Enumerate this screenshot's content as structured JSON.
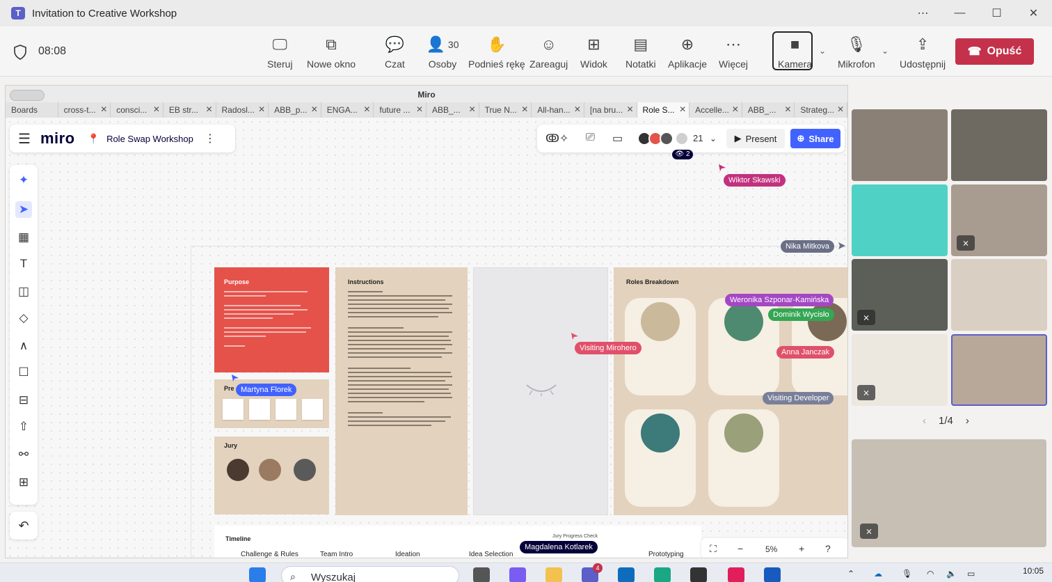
{
  "window": {
    "title": "Invitation to Creative Workshop"
  },
  "meeting": {
    "timer": "08:08",
    "toolbar": [
      {
        "label": "Steruj",
        "icon": "control-icon"
      },
      {
        "label": "Nowe okno",
        "icon": "popout-icon"
      },
      {
        "label": "Czat",
        "icon": "chat-icon"
      },
      {
        "label": "Osoby",
        "icon": "people-icon",
        "count": "30"
      },
      {
        "label": "Podnieś rękę",
        "icon": "raise-hand-icon"
      },
      {
        "label": "Zareaguj",
        "icon": "react-icon"
      },
      {
        "label": "Widok",
        "icon": "view-icon"
      },
      {
        "label": "Notatki",
        "icon": "notes-icon"
      },
      {
        "label": "Aplikacje",
        "icon": "apps-icon"
      },
      {
        "label": "Więcej",
        "icon": "more-icon"
      },
      {
        "label": "Kamera",
        "icon": "camera-icon"
      },
      {
        "label": "Mikrofon",
        "icon": "mic-off-icon"
      },
      {
        "label": "Udostępnij",
        "icon": "share-icon"
      }
    ],
    "leave_label": "Opuść",
    "leave_color": "#c4314b"
  },
  "browser": {
    "title": "Miro",
    "tabs": [
      "Boards",
      "cross-t...",
      "consci...",
      "EB str...",
      "Radosl...",
      "ABB_p...",
      "ENGA...",
      "future ...",
      "ABB_...",
      "True N...",
      "All-han...",
      "[na bru...",
      "Role S...",
      "Accelle...",
      "ABB_...",
      "Strateg..."
    ],
    "active_tab": 12
  },
  "miro": {
    "logo": "miro",
    "board_name": "Role Swap Workshop",
    "collaborator_count": "21",
    "viewers": "2",
    "present_label": "Present",
    "share_label": "Share",
    "accent": "#4262ff",
    "zoom": "5%",
    "cards": {
      "purpose_title": "Purpose",
      "pre_title": "Pre",
      "jury_title": "Jury",
      "instructions_title": "Instructions",
      "roles_title": "Roles Breakdown"
    },
    "timeline": {
      "title": "Timeline",
      "progress_check": "Jury Progress Check",
      "steps": [
        "Challenge & Rules",
        "Team Intro",
        "Ideation",
        "Idea Selection",
        "Prototyping"
      ]
    },
    "cursors": [
      {
        "name": "Wiktor Skawski",
        "color": "#c2317e"
      },
      {
        "name": "Nika Mitkova",
        "color": "#6b6f86"
      },
      {
        "name": "Weronika Szponar-Kamińska",
        "color": "#a347c4"
      },
      {
        "name": "Dominik Wycisło",
        "color": "#35a653"
      },
      {
        "name": "Visiting Mirohero",
        "color": "#e0506a"
      },
      {
        "name": "Anna Janczak",
        "color": "#e0506a"
      },
      {
        "name": "Visiting Developer",
        "color": "#7a7f99"
      },
      {
        "name": "Martyna Florek",
        "color": "#4262ff"
      },
      {
        "name": "Magdalena Kotlarek",
        "color": "#050038"
      }
    ]
  },
  "gallery": {
    "page": "1/4"
  },
  "taskbar": {
    "search_placeholder": "Wyszukaj",
    "teams_badge": "4",
    "time": "10:05"
  }
}
